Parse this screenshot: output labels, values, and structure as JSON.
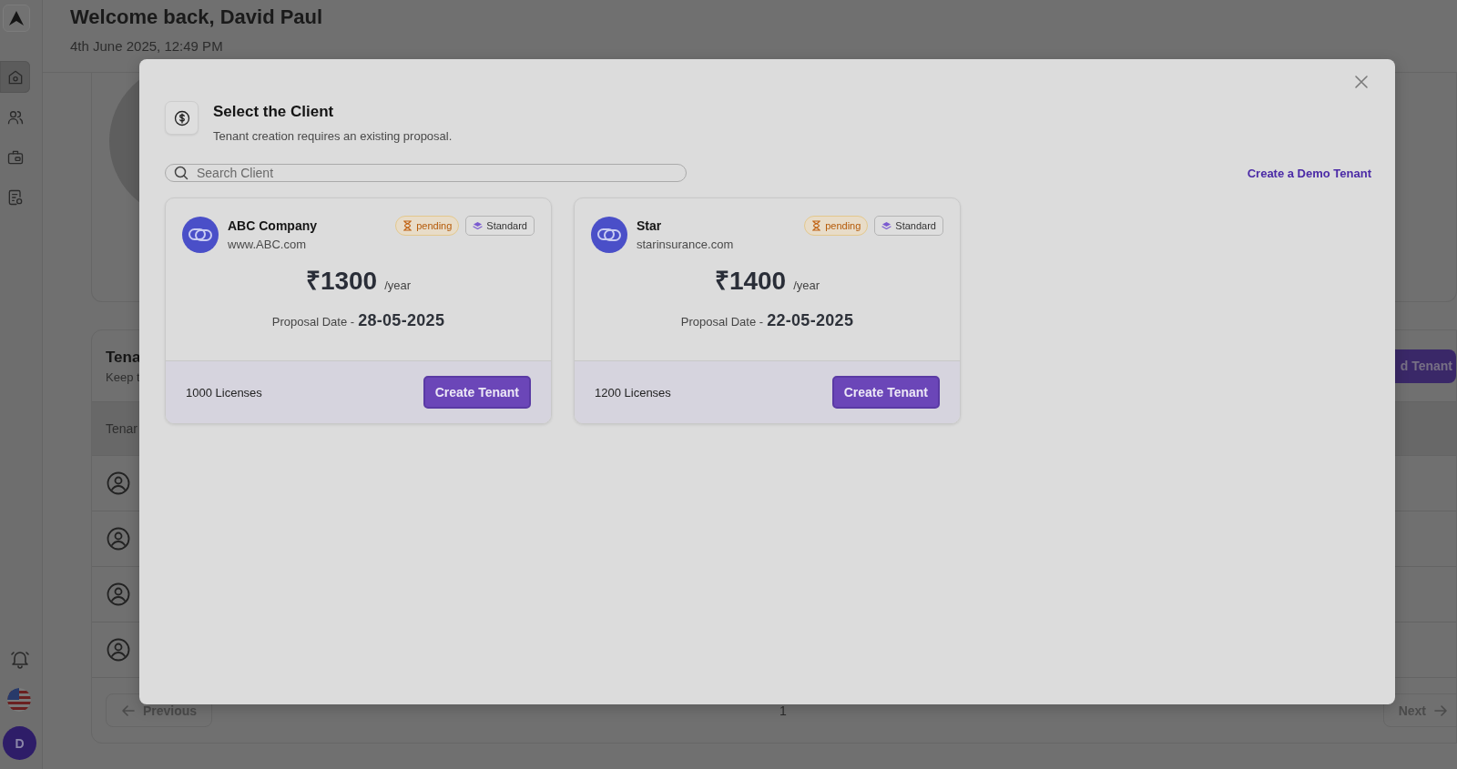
{
  "sidebar": {
    "nav_items": [
      {
        "kind": "home",
        "selected": true
      },
      {
        "kind": "users",
        "selected": false
      },
      {
        "kind": "briefcase",
        "selected": false
      },
      {
        "kind": "report",
        "selected": false
      }
    ],
    "avatar_initial": "D"
  },
  "header": {
    "title": "Welcome back, David Paul",
    "date": "4th June 2025, 12:49 PM"
  },
  "tenants_panel": {
    "title": "Tena",
    "subtitle": "Keep t",
    "add_button": "d Tenant",
    "column_1": "Tenar",
    "rows": [
      {
        "kind": "user"
      },
      {
        "kind": "user"
      },
      {
        "kind": "user"
      },
      {
        "kind": "user"
      }
    ],
    "previous": "Previous",
    "page": "1",
    "next": "Next"
  },
  "modal": {
    "title": "Select the Client",
    "subtitle": "Tenant creation requires an existing proposal.",
    "search": {
      "placeholder": "Search Client"
    },
    "demo_link": "Create a Demo Tenant",
    "clients": [
      {
        "name": "ABC Company",
        "website": "www.ABC.com",
        "status": "pending",
        "plan": "Standard",
        "price": "₹1300",
        "period": "/year",
        "date_label": "Proposal Date -",
        "date": "28-05-2025",
        "licenses": "1000 Licenses",
        "action": "Create Tenant"
      },
      {
        "name": "Star",
        "website": "starinsurance.com",
        "status": "pending",
        "plan": "Standard",
        "price": "₹1400",
        "period": "/year",
        "date_label": "Proposal Date -",
        "date": "22-05-2025",
        "licenses": "1200 Licenses",
        "action": "Create Tenant"
      }
    ]
  }
}
